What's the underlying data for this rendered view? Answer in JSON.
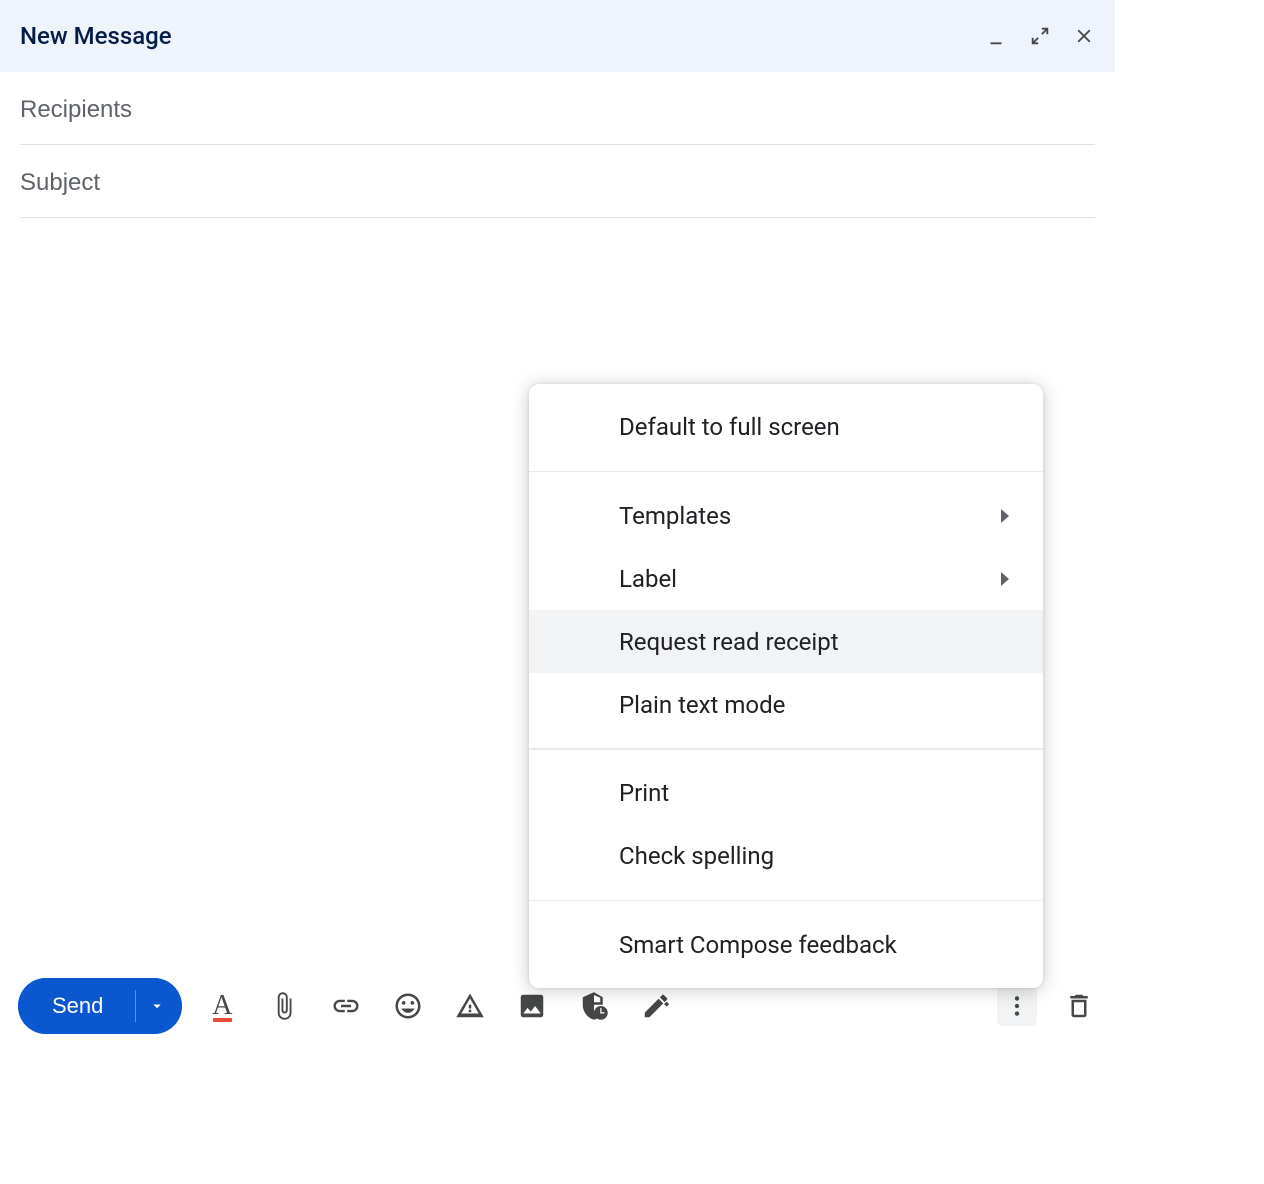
{
  "header": {
    "title": "New Message"
  },
  "fields": {
    "recipients_placeholder": "Recipients",
    "subject_placeholder": "Subject"
  },
  "footer": {
    "send_label": "Send"
  },
  "menu": {
    "items": [
      {
        "label": "Default to full screen",
        "has_arrow": false,
        "highlighted": false,
        "divider_after": true
      },
      {
        "label": "Templates",
        "has_arrow": true,
        "highlighted": false,
        "divider_after": false
      },
      {
        "label": "Label",
        "has_arrow": true,
        "highlighted": false,
        "divider_after": false
      },
      {
        "label": "Request read receipt",
        "has_arrow": false,
        "highlighted": true,
        "divider_after": false
      },
      {
        "label": "Plain text mode",
        "has_arrow": false,
        "highlighted": false,
        "divider_after": true
      },
      {
        "label": "Print",
        "has_arrow": false,
        "highlighted": false,
        "divider_after": false
      },
      {
        "label": "Check spelling",
        "has_arrow": false,
        "highlighted": false,
        "divider_after": true
      },
      {
        "label": "Smart Compose feedback",
        "has_arrow": false,
        "highlighted": false,
        "divider_after": false
      }
    ]
  }
}
